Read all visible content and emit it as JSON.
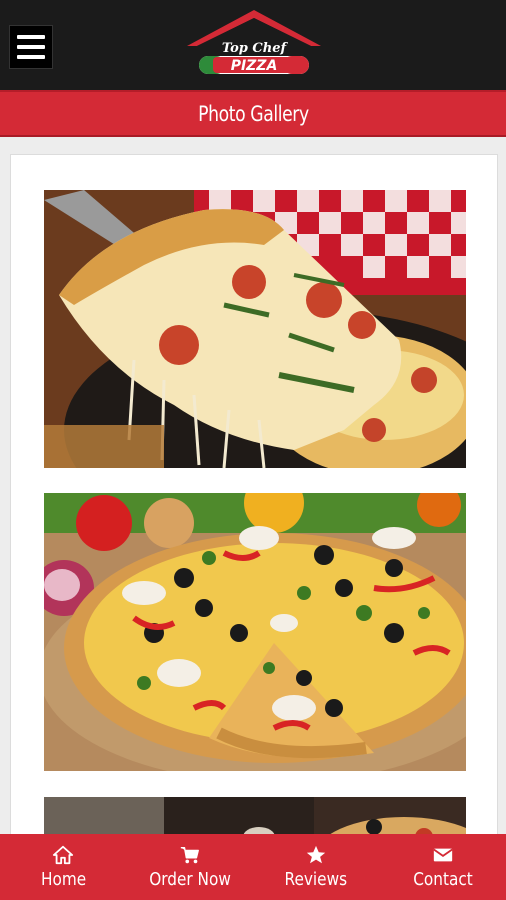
{
  "header": {
    "logo_text_top": "Top Chef",
    "logo_text_bottom": "PIZZA",
    "menu_icon": "hamburger-menu-icon"
  },
  "page": {
    "title": "Photo Gallery"
  },
  "gallery": {
    "items": [
      {
        "subject": "cheesy-pepperoni-slice"
      },
      {
        "subject": "vegetable-pizza"
      },
      {
        "subject": "pizza-partial"
      }
    ]
  },
  "nav": {
    "home_label": "Home",
    "home_icon": "home-icon",
    "order_label": "Order Now",
    "order_icon": "cart-icon",
    "reviews_label": "Reviews",
    "reviews_icon": "star-icon",
    "contact_label": "Contact",
    "contact_icon": "mail-icon"
  },
  "colors": {
    "header_bg": "#1b1b1b",
    "accent_red": "#d42a36",
    "page_bg": "#ededed"
  }
}
